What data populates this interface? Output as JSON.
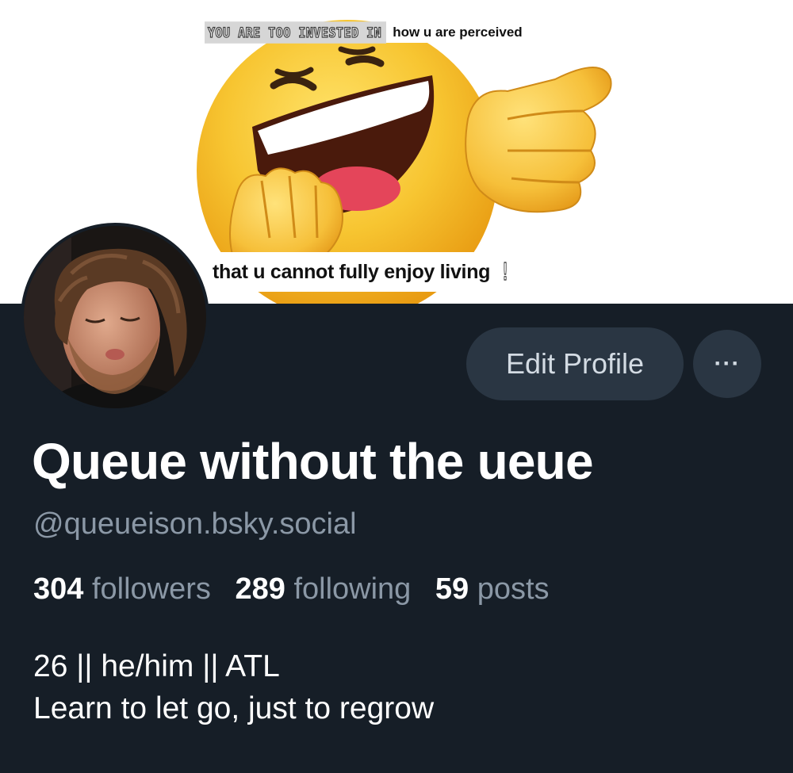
{
  "banner": {
    "caption_top_caps": "YOU ARE TOO INVESTED IN",
    "caption_top_lower": "how u are perceived",
    "caption_bottom": "that u cannot fully enjoy living",
    "caption_bottom_mark": "!"
  },
  "actions": {
    "edit_profile_label": "Edit Profile",
    "more_label": "···"
  },
  "profile": {
    "display_name": "Queue without the ueue",
    "handle": "@queueison.bsky.social",
    "stats": [
      {
        "count": "304",
        "label": "followers"
      },
      {
        "count": "289",
        "label": "following"
      },
      {
        "count": "59",
        "label": "posts"
      }
    ],
    "bio_lines": [
      "26 || he/him || ATL",
      "Learn to let go, just to regrow"
    ]
  },
  "colors": {
    "background": "#161e27",
    "button_bg": "#2a3643",
    "muted_text": "#8b98a6",
    "emoji_yellow": "#f7c531"
  }
}
